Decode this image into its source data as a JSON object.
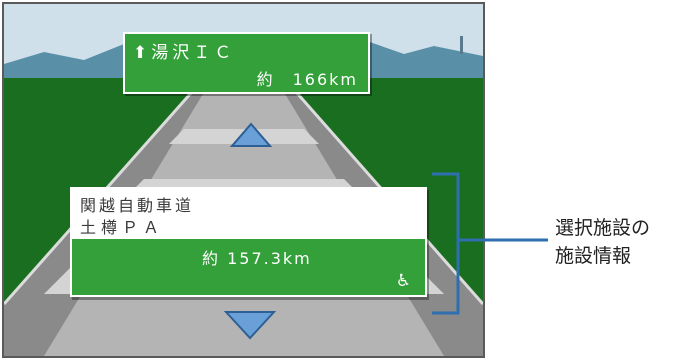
{
  "top_sign": {
    "arrow_icon": "up-arrow",
    "destination": "湯沢ＩＣ",
    "distance": "約　166km"
  },
  "facility": {
    "road": "関越自動車道",
    "name": "土樽ＰＡ",
    "distance": "約 157.3km",
    "amenity_icon": "wheelchair-icon",
    "amenity_glyph": "♿"
  },
  "callout": {
    "line1": "選択施設の",
    "line2": "施設情報"
  },
  "colors": {
    "sign_green": "#33a03a",
    "grass": "#1a6e1f",
    "sky": "#cfe0ea",
    "bracket": "#2f6fb0",
    "arrow": "#6aa0d8"
  }
}
